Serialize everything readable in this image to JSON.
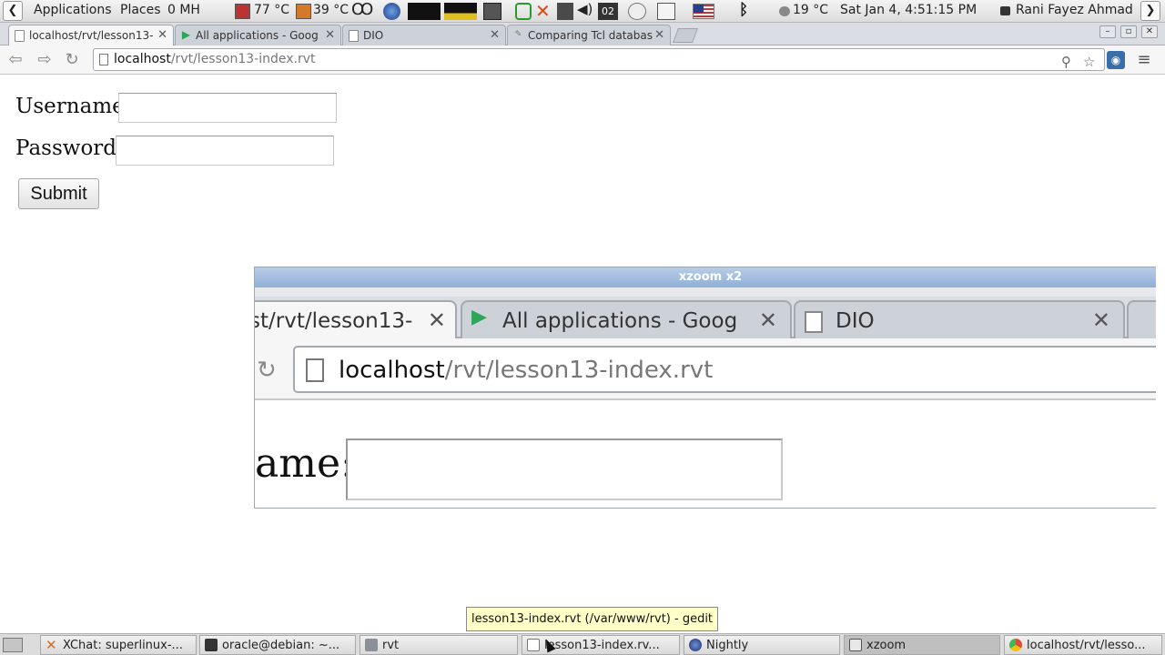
{
  "top_panel": {
    "applications": "Applications",
    "places": "Places",
    "cpu_label": "0 MH",
    "temp1": "77 °C",
    "temp2": "39 °C",
    "weather": "19 °C",
    "datetime": "Sat Jan  4,  4:51:15 PM",
    "user": "Rani Fayez Ahmad",
    "calendar_day": "02"
  },
  "browser": {
    "tabs": [
      {
        "label": "localhost/rvt/lesson13-",
        "active": true
      },
      {
        "label": "All applications - Goog",
        "active": false
      },
      {
        "label": "DIO",
        "active": false
      },
      {
        "label": "Comparing Tcl databas",
        "active": false
      }
    ],
    "url_host": "localhost",
    "url_path": "/rvt/lesson13-index.rvt"
  },
  "form": {
    "username_label": "Username:",
    "password_label": "Password:",
    "username_value": "",
    "password_value": "",
    "submit_label": "Submit"
  },
  "xzoom": {
    "title": "xzoom x2",
    "tab1_label": "st/rvt/lesson13-",
    "tab2_label": "All applications - Goog",
    "tab3_label": "DIO",
    "url_host": "localhost",
    "url_path": "/rvt/lesson13-index.rvt",
    "label_fragment": "ame:"
  },
  "tooltip": "lesson13-index.rvt (/var/www/rvt) - gedit",
  "taskbar": {
    "items": [
      {
        "label": "XChat: superlinux-...",
        "icon": "xchat-icon",
        "color": "#e06a1a"
      },
      {
        "label": "oracle@debian: ~...",
        "icon": "terminal-icon",
        "color": "#333333"
      },
      {
        "label": "rvt",
        "icon": "folder-icon",
        "color": "#8a8f98"
      },
      {
        "label": "lesson13-index.rv...",
        "icon": "gedit-icon",
        "color": "#9a9a9a"
      },
      {
        "label": "Nightly",
        "icon": "nightly-icon",
        "color": "#2f4fa0"
      },
      {
        "label": "xzoom",
        "icon": "window-icon",
        "color": "#8a8f98"
      },
      {
        "label": "localhost/rvt/lesso...",
        "icon": "chrome-icon",
        "color": "#dd4b39"
      }
    ]
  }
}
